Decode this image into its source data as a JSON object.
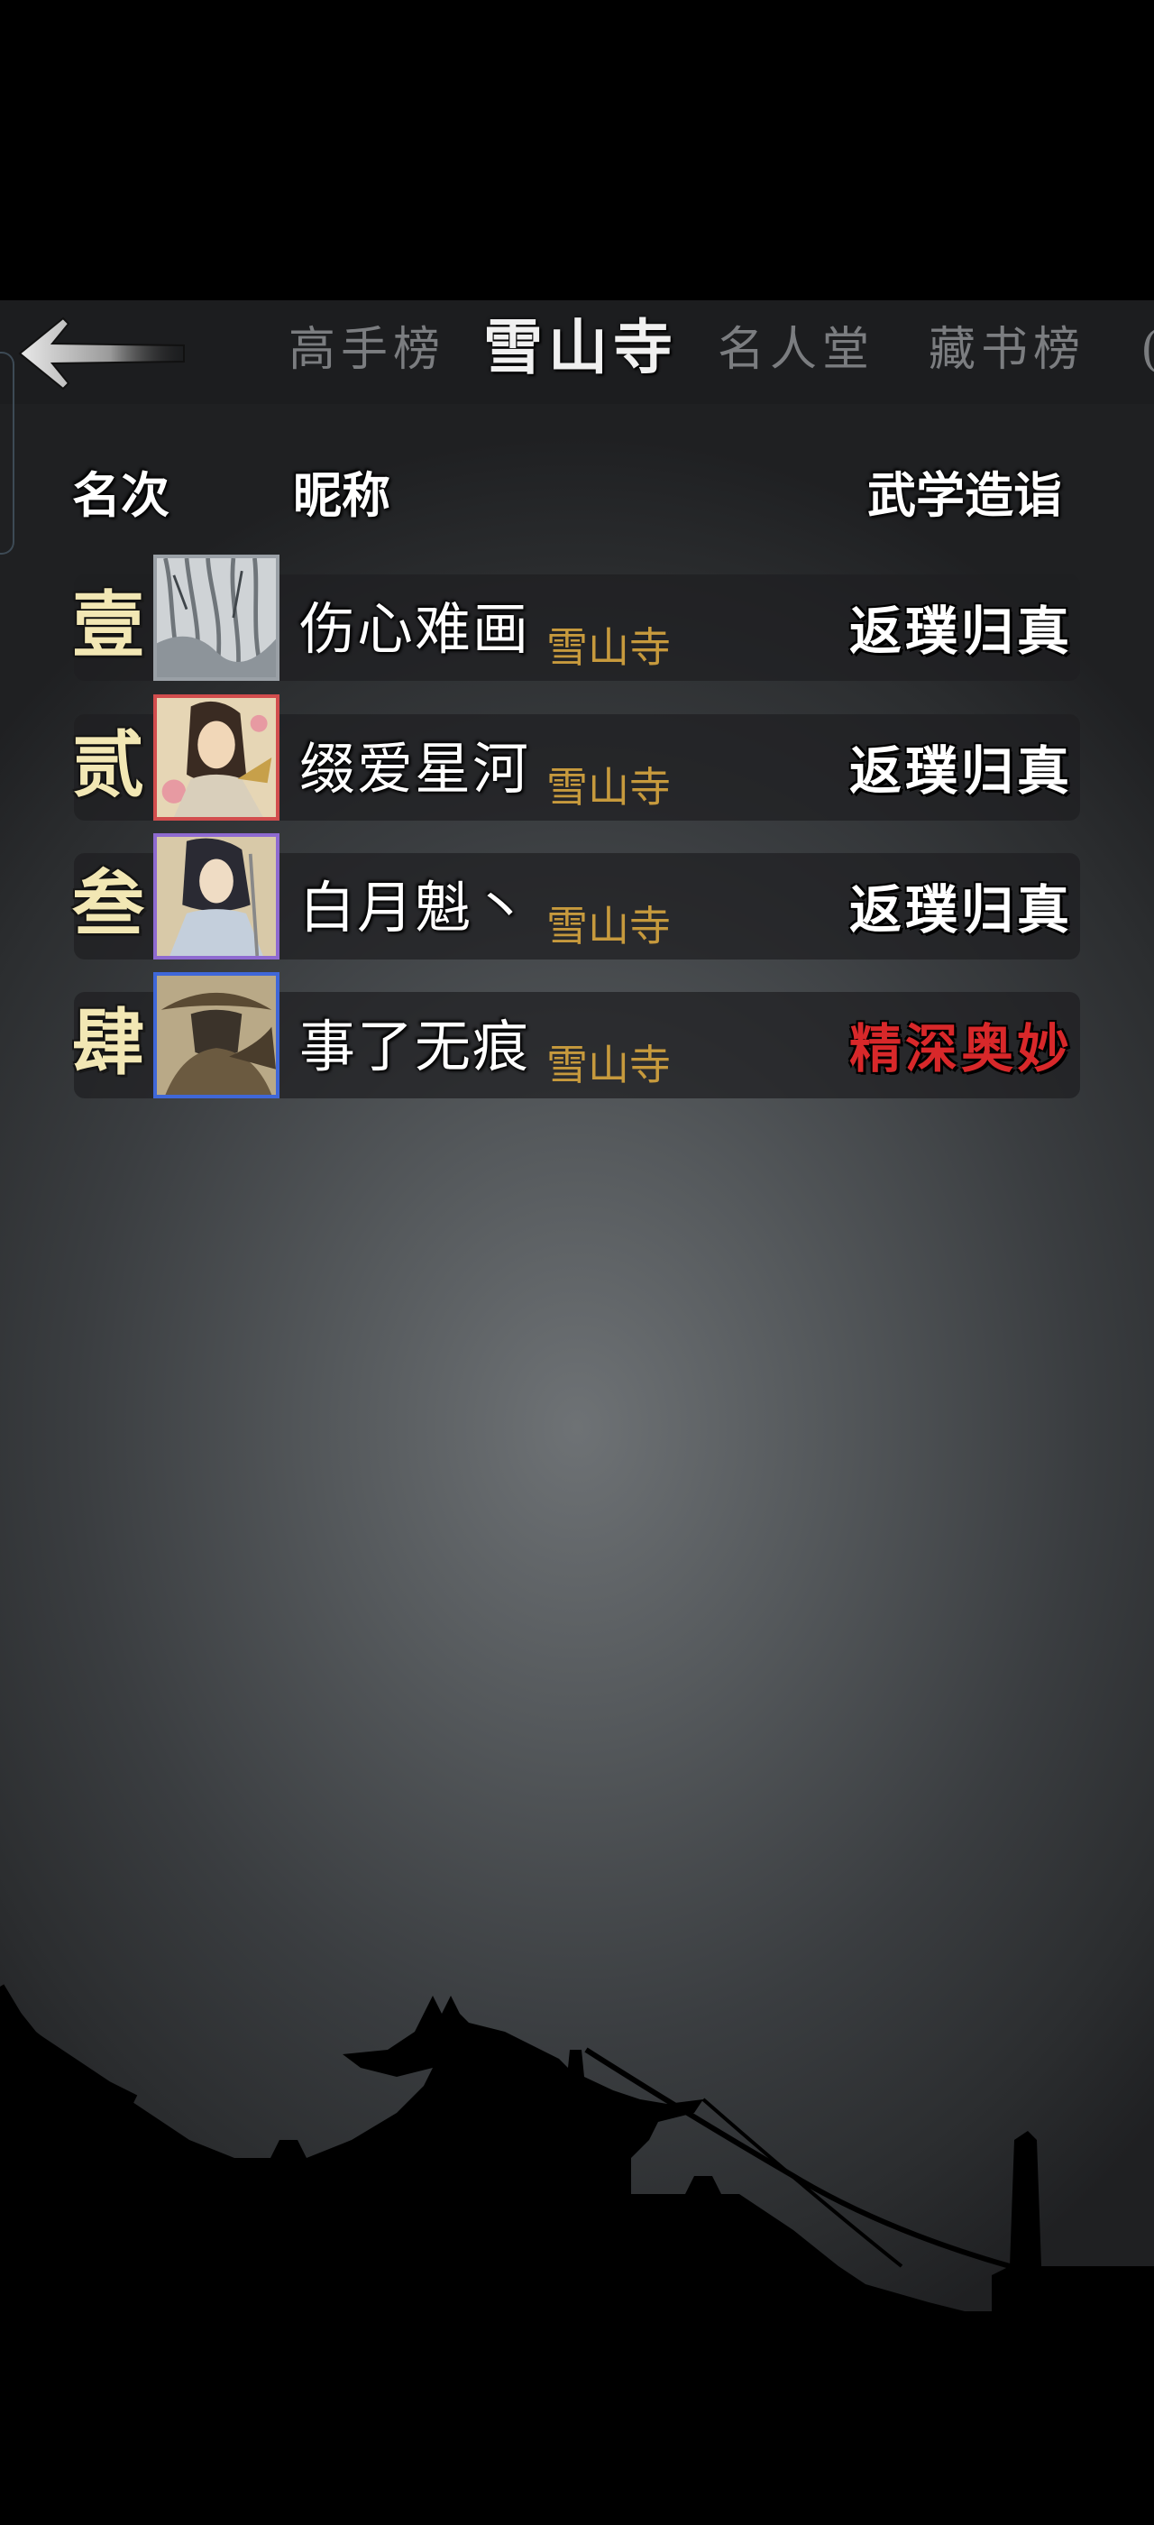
{
  "nav": {
    "back_icon": "arrow-left-icon",
    "tabs": [
      {
        "label": "高手榜",
        "active": false
      },
      {
        "label": "雪山寺",
        "active": true
      },
      {
        "label": "名人堂",
        "active": false
      },
      {
        "label": "藏书榜",
        "active": false
      },
      {
        "label": "(",
        "active": false
      }
    ]
  },
  "table": {
    "headers": {
      "rank": "名次",
      "nickname": "昵称",
      "skill": "武学造诣"
    },
    "rows": [
      {
        "rank": "壹",
        "nickname": "伤心难画",
        "sect": "雪山寺",
        "skill": "返璞归真",
        "skill_color": "#ffffff",
        "avatar": "ink-landscape-avatar"
      },
      {
        "rank": "贰",
        "nickname": "缀爱星河",
        "sect": "雪山寺",
        "skill": "返璞归真",
        "skill_color": "#ffffff",
        "avatar": "swordswoman-fan-avatar"
      },
      {
        "rank": "叁",
        "nickname": "白月魁丶",
        "sect": "雪山寺",
        "skill": "返璞归真",
        "skill_color": "#ffffff",
        "avatar": "swordsman-white-robe-avatar"
      },
      {
        "rank": "肆",
        "nickname": "事了无痕",
        "sect": "雪山寺",
        "skill": "精深奥妙",
        "skill_color": "#d8282a",
        "avatar": "straw-hat-rider-avatar"
      }
    ]
  },
  "colors": {
    "rank": "#f2e7b4",
    "sect": "#c79a3d",
    "accent_red": "#d8282a"
  }
}
